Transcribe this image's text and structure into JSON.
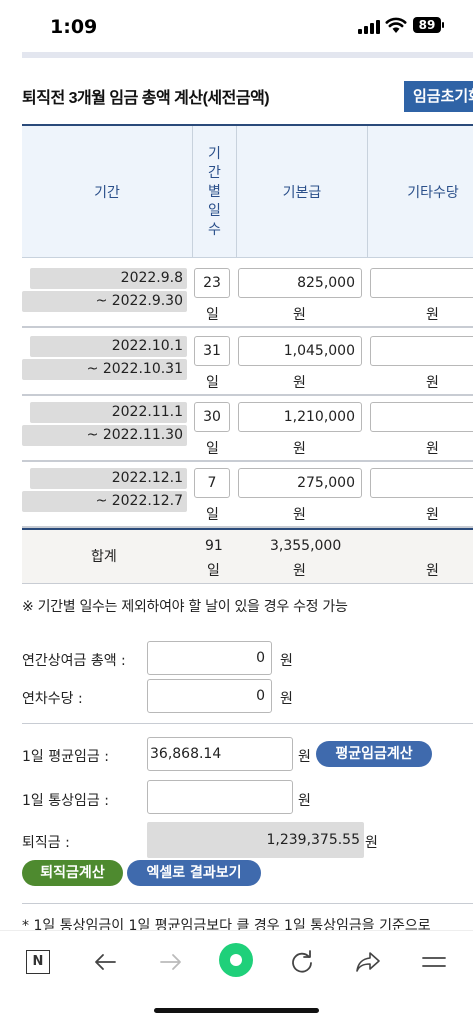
{
  "status": {
    "time": "1:09",
    "battery": "89"
  },
  "title": "퇴직전 3개월 임금 총액 계산(세전금액)",
  "reset_button": "임금초기화",
  "table": {
    "headers": {
      "period": "기간",
      "days": "기간별일수",
      "basic": "기본급",
      "other": "기타수당"
    },
    "rows": [
      {
        "start": "2022.9.8",
        "end": "~ 2022.9.30",
        "days": "23",
        "basic": "825,000",
        "other": ""
      },
      {
        "start": "2022.10.1",
        "end": "~ 2022.10.31",
        "days": "31",
        "basic": "1,045,000",
        "other": ""
      },
      {
        "start": "2022.11.1",
        "end": "~ 2022.11.30",
        "days": "30",
        "basic": "1,210,000",
        "other": ""
      },
      {
        "start": "2022.12.1",
        "end": "~ 2022.12.7",
        "days": "7",
        "basic": "275,000",
        "other": ""
      }
    ],
    "unit_day": "일",
    "unit_won": "원",
    "sum": {
      "label": "합계",
      "days": "91",
      "basic": "3,355,000"
    }
  },
  "note": "※ 기간별 일수는 제외하여야 할 날이 있을 경우 수정 가능",
  "bonus": {
    "label": "연간상여금 총액 :",
    "value": "0"
  },
  "annual_leave": {
    "label": "연차수당 :",
    "value": "0"
  },
  "avg_wage": {
    "label": "1일 평균임금 :",
    "value": "36,868.14",
    "button": "평균임금계산"
  },
  "ordinary_wage": {
    "label": "1일 통상임금 :",
    "value": ""
  },
  "severance": {
    "label": "퇴직금 :",
    "value": "1,239,375.55"
  },
  "calc_button": "퇴직금계산",
  "excel_button": "엑셀로 결과보기",
  "footnote": "* 1일 통상임금이 1일 평균임금보다 클 경우 1일 통상임금을 기준으로",
  "toolbar": {
    "n_label": "N"
  }
}
